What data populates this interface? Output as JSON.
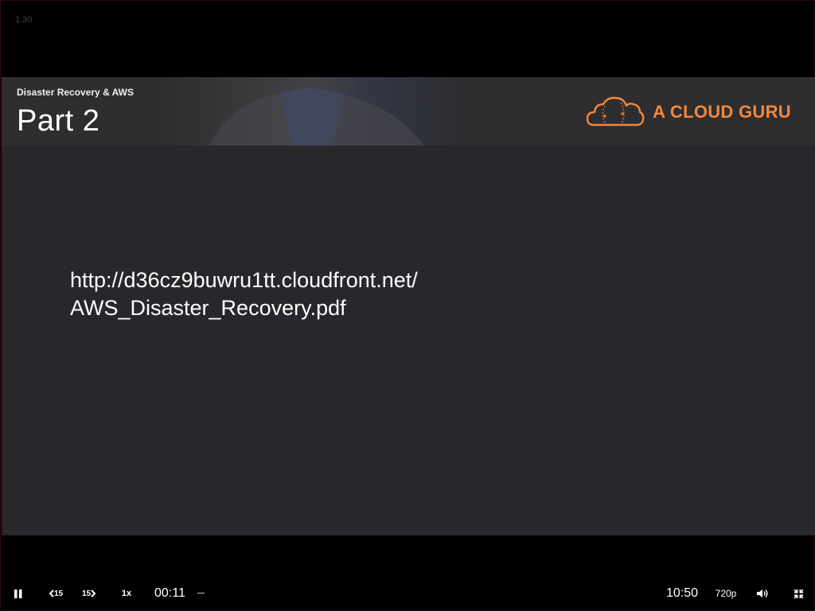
{
  "player": {
    "version": "1.30",
    "brand_color": "#f2883a",
    "header_background": "#2e2d30",
    "slide_background": "#28272b"
  },
  "slide": {
    "course_title": "Disaster Recovery & AWS",
    "part_title": "Part 2",
    "brand_name": "A CLOUD GURU",
    "link_line_1": "http://d36cz9buwru1tt.cloudfront.net/",
    "link_line_2": "AWS_Disaster_Recovery.pdf"
  },
  "controls": {
    "play_state_icon": "pause-icon",
    "rewind_label": "15",
    "forward_label": "15",
    "speed_label": "1x",
    "current_time": "00:11",
    "duration": "10:50",
    "quality_label": "720p",
    "volume_icon": "volume-icon",
    "fullscreen_icon": "exit-fullscreen-icon"
  }
}
